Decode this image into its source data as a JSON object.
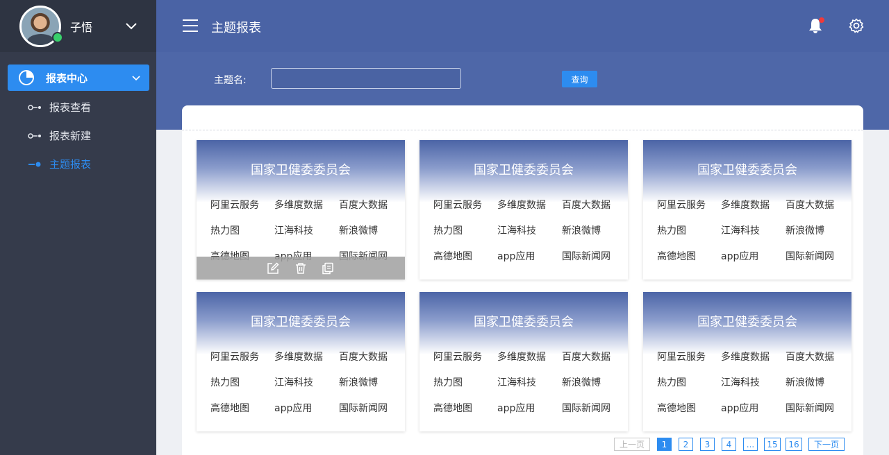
{
  "user": {
    "name": "子悟"
  },
  "sidebar": {
    "main_item": "报表中心",
    "sub_items": [
      {
        "label": "报表查看"
      },
      {
        "label": "报表新建"
      },
      {
        "label": "主题报表"
      }
    ]
  },
  "header": {
    "title": "主题报表"
  },
  "search": {
    "label": "主题名:",
    "value": "",
    "button": "查询"
  },
  "cards": [
    {
      "title": "国家卫健委委员会",
      "tags": [
        "阿里云服务",
        "多维度数据",
        "百度大数据",
        "热力图",
        "江海科技",
        "新浪微博",
        "高德地图",
        "app应用",
        "国际新闻网"
      ]
    },
    {
      "title": "国家卫健委委员会",
      "tags": [
        "阿里云服务",
        "多维度数据",
        "百度大数据",
        "热力图",
        "江海科技",
        "新浪微博",
        "高德地图",
        "app应用",
        "国际新闻网"
      ]
    },
    {
      "title": "国家卫健委委员会",
      "tags": [
        "阿里云服务",
        "多维度数据",
        "百度大数据",
        "热力图",
        "江海科技",
        "新浪微博",
        "高德地图",
        "app应用",
        "国际新闻网"
      ]
    },
    {
      "title": "国家卫健委委员会",
      "tags": [
        "阿里云服务",
        "多维度数据",
        "百度大数据",
        "热力图",
        "江海科技",
        "新浪微博",
        "高德地图",
        "app应用",
        "国际新闻网"
      ]
    },
    {
      "title": "国家卫健委委员会",
      "tags": [
        "阿里云服务",
        "多维度数据",
        "百度大数据",
        "热力图",
        "江海科技",
        "新浪微博",
        "高德地图",
        "app应用",
        "国际新闻网"
      ]
    },
    {
      "title": "国家卫健委委员会",
      "tags": [
        "阿里云服务",
        "多维度数据",
        "百度大数据",
        "热力图",
        "江海科技",
        "新浪微博",
        "高德地图",
        "app应用",
        "国际新闻网"
      ]
    }
  ],
  "pagination": {
    "prev": "上一页",
    "pages": [
      "1",
      "2",
      "3",
      "4",
      "...",
      "15",
      "16"
    ],
    "current": "1",
    "next": "下一页"
  },
  "colors": {
    "accent": "#2d8cf0",
    "header": "#4a63a5",
    "sidebar": "#353b4b",
    "notification": "#f03a3a",
    "online": "#38d06b"
  },
  "icons": [
    "user-chevron-icon",
    "pie-chart-icon",
    "chevron-down-icon",
    "hamburger-icon",
    "bell-icon",
    "gear-icon",
    "edit-icon",
    "trash-icon",
    "copy-icon"
  ]
}
